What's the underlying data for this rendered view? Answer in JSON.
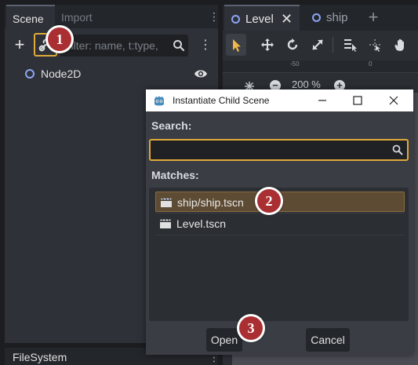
{
  "scene_dock": {
    "tabs": [
      {
        "label": "Scene"
      },
      {
        "label": "Import"
      }
    ],
    "filter_placeholder": "Filter: name, t:type,",
    "tree": [
      {
        "label": "Node2D"
      }
    ]
  },
  "filesystem_dock": {
    "label": "FileSystem"
  },
  "editor": {
    "tabs": [
      {
        "label": "Level"
      },
      {
        "label": "ship"
      }
    ],
    "ruler_ticks": [
      "-50",
      "0"
    ],
    "zoom": "200 %"
  },
  "dialog": {
    "title": "Instantiate Child Scene",
    "search_label": "Search:",
    "search_value": "",
    "matches_label": "Matches:",
    "matches": [
      {
        "label": "ship/ship.tscn",
        "selected": true
      },
      {
        "label": "Level.tscn",
        "selected": false
      }
    ],
    "open_label": "Open",
    "cancel_label": "Cancel"
  },
  "badges": [
    "1",
    "2",
    "3"
  ],
  "colors": {
    "focus_border": "#e0a93a",
    "selected_row": "#5e4b33",
    "badge_red": "#a92f32",
    "node_icon": "#8da5f3"
  }
}
